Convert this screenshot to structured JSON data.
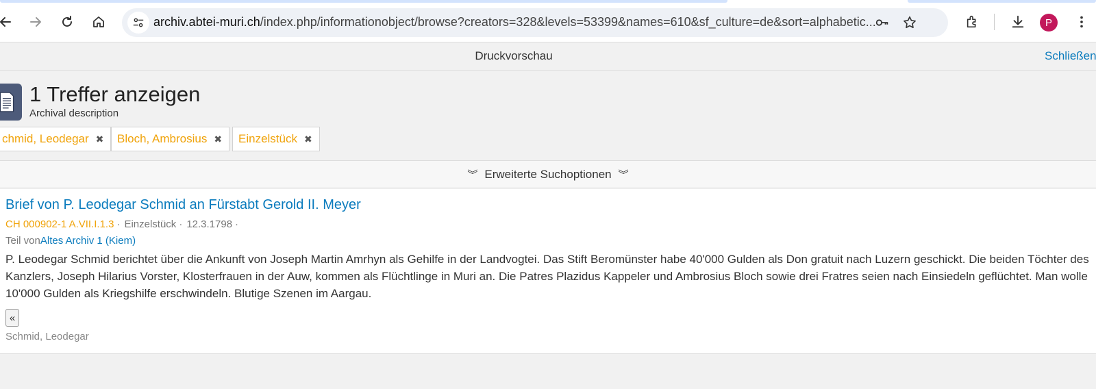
{
  "browser": {
    "url_host": "archiv.abtei-muri.ch",
    "url_rest": "/index.php/informationobject/browse?creators=328&levels=53399&names=610&sf_culture=de&sort=alphabetic...",
    "profile_initial": "P"
  },
  "print_bar": {
    "title": "Druckvorschau",
    "close_label": "Schließen"
  },
  "header": {
    "title": "1 Treffer anzeigen",
    "subtitle": "Archival description"
  },
  "filters": [
    {
      "label": "chmid, Leodegar"
    },
    {
      "label": "Bloch, Ambrosius"
    },
    {
      "label": "Einzelstück"
    }
  ],
  "advanced_search": {
    "label": "Erweiterte Suchoptionen"
  },
  "result": {
    "title": "Brief von P. Leodegar Schmid an Fürstabt Gerold II. Meyer",
    "reference": "CH 000902-1 A.VII.I.1.3",
    "level": "Einzelstück",
    "date": "12.3.1798",
    "part_of_prefix": "Teil von",
    "part_of_link": "Altes Archiv 1 (Kiem)",
    "description": "P. Leodegar Schmid berichtet über die Ankunft von Joseph Martin Amrhyn als Gehilfe in der Landvogtei. Das Stift Beromünster habe 40'000 Gulden als Don gratuit nach Luzern geschickt. Die beiden Töchter des Kanzlers, Joseph Hilarius Vorster, Klosterfrauen in der Auw, kommen als Flüchtlinge in Muri an. Die Patres Plazidus Kappeler und Ambrosius Bloch sowie drei Fratres seien nach Einsiedeln geflüchtet. Man wolle 10'000 Gulden als Kriegshilfe erschwindeln. Blutige Szenen im Aargau.",
    "back_label": "«",
    "creator": "Schmid, Leodegar"
  }
}
